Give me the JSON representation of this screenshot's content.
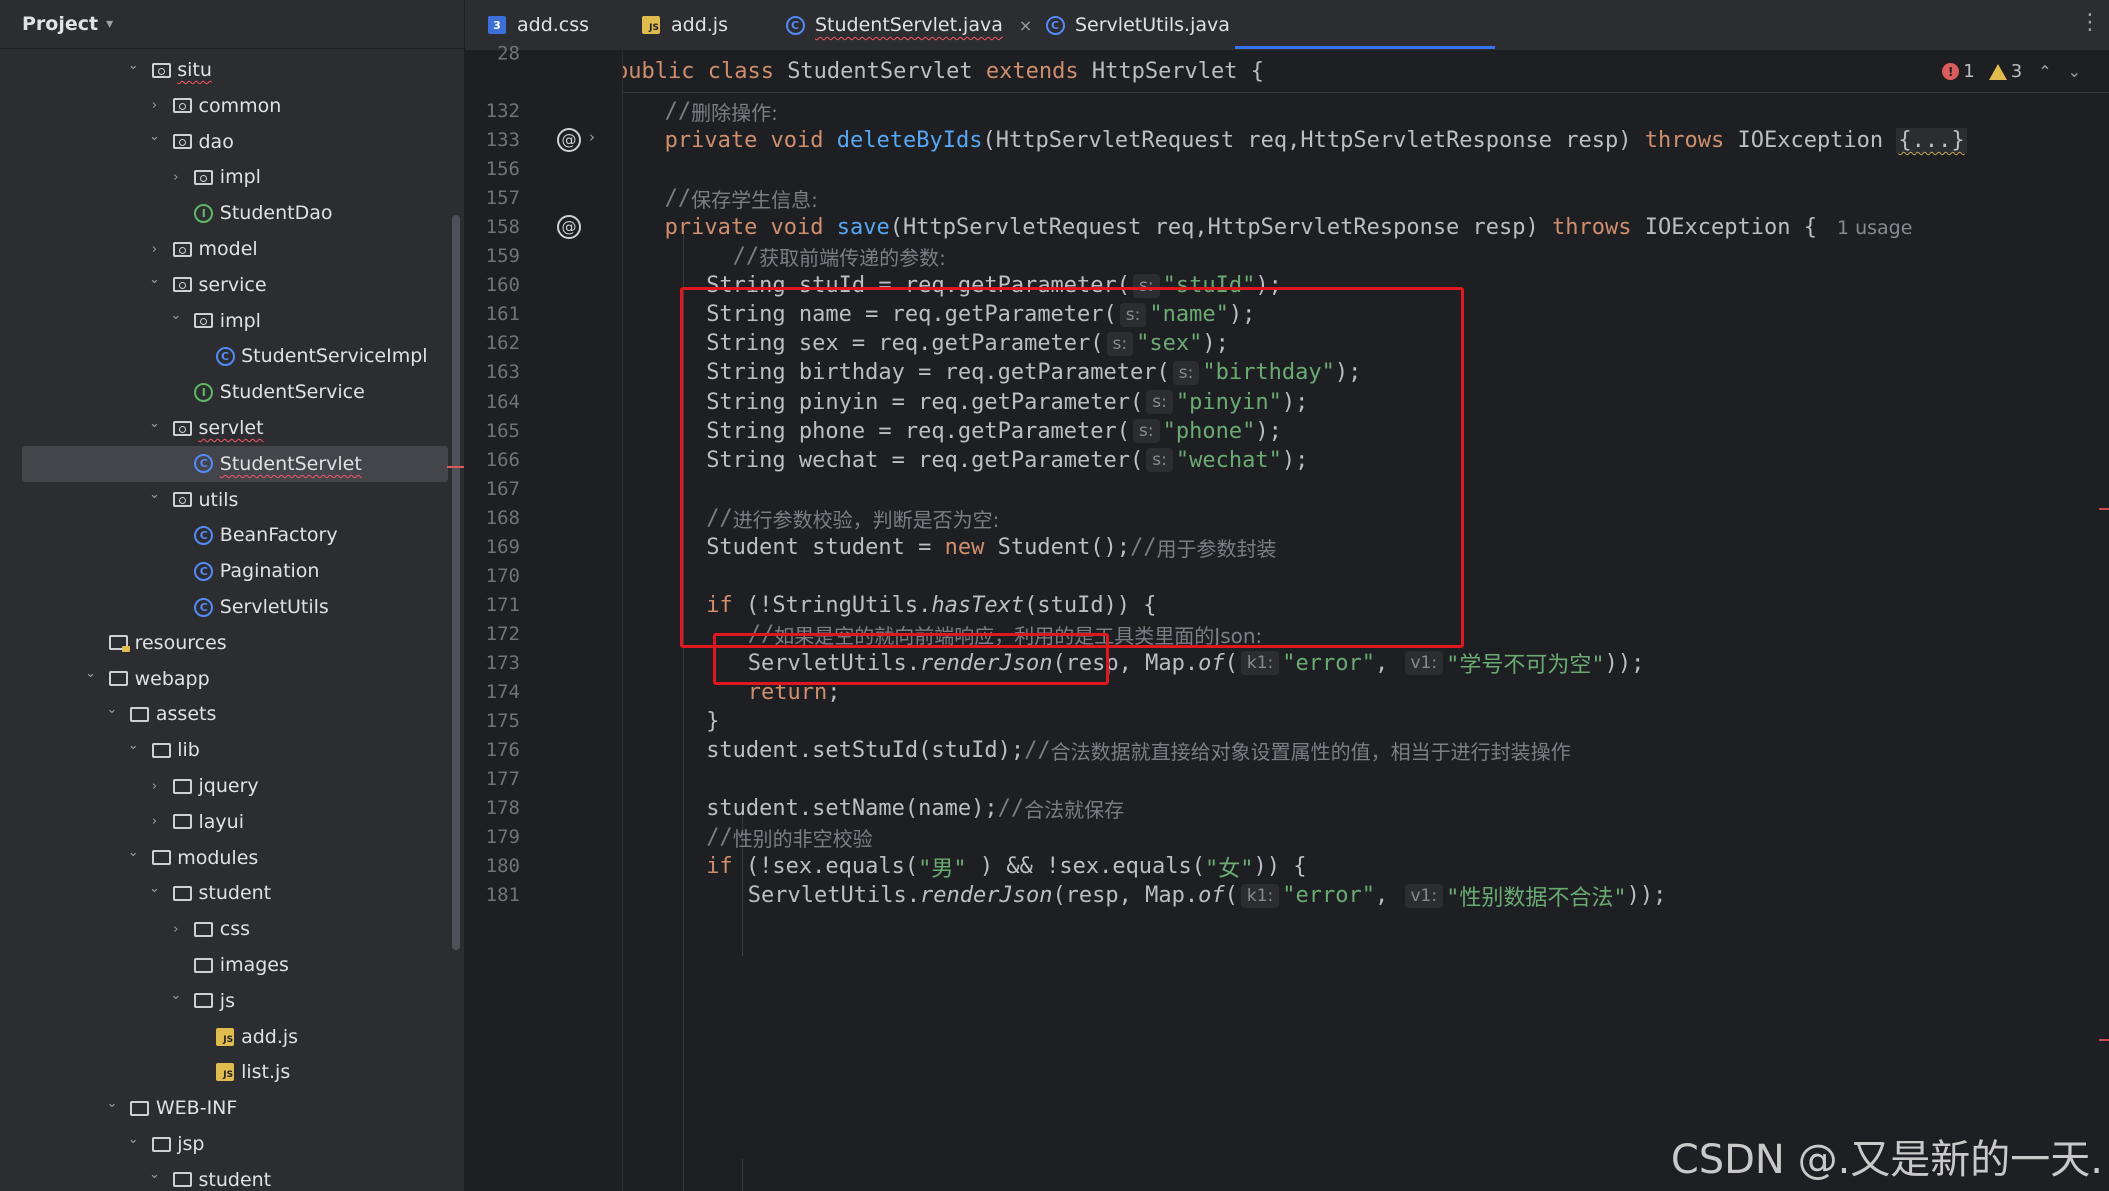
{
  "project": {
    "title": "Project",
    "tree": [
      {
        "label": "situ",
        "type": "package",
        "chev": "v",
        "indent": 4,
        "squig": true
      },
      {
        "label": "common",
        "type": "package",
        "chev": ">",
        "indent": 5
      },
      {
        "label": "dao",
        "type": "package",
        "chev": "v",
        "indent": 5
      },
      {
        "label": "impl",
        "type": "package",
        "chev": ">",
        "indent": 6
      },
      {
        "label": "StudentDao",
        "type": "interface",
        "chev": "",
        "indent": 6
      },
      {
        "label": "model",
        "type": "package",
        "chev": ">",
        "indent": 5
      },
      {
        "label": "service",
        "type": "package",
        "chev": "v",
        "indent": 5
      },
      {
        "label": "impl",
        "type": "package",
        "chev": "v",
        "indent": 6
      },
      {
        "label": "StudentServiceImpl",
        "type": "class",
        "chev": "",
        "indent": 7
      },
      {
        "label": "StudentService",
        "type": "interface",
        "chev": "",
        "indent": 6
      },
      {
        "label": "servlet",
        "type": "package",
        "chev": "v",
        "indent": 5,
        "squig": true
      },
      {
        "label": "StudentServlet",
        "type": "class",
        "chev": "",
        "indent": 6,
        "squig": true,
        "selected": true
      },
      {
        "label": "utils",
        "type": "package",
        "chev": "v",
        "indent": 5
      },
      {
        "label": "BeanFactory",
        "type": "class",
        "chev": "",
        "indent": 6
      },
      {
        "label": "Pagination",
        "type": "class",
        "chev": "",
        "indent": 6
      },
      {
        "label": "ServletUtils",
        "type": "class",
        "chev": "",
        "indent": 6
      },
      {
        "label": "resources",
        "type": "resources",
        "chev": "",
        "indent": 2
      },
      {
        "label": "webapp",
        "type": "folder",
        "chev": "v",
        "indent": 2
      },
      {
        "label": "assets",
        "type": "folder",
        "chev": "v",
        "indent": 3
      },
      {
        "label": "lib",
        "type": "folder",
        "chev": "v",
        "indent": 4
      },
      {
        "label": "jquery",
        "type": "folder",
        "chev": ">",
        "indent": 5
      },
      {
        "label": "layui",
        "type": "folder",
        "chev": ">",
        "indent": 5
      },
      {
        "label": "modules",
        "type": "folder",
        "chev": "v",
        "indent": 4
      },
      {
        "label": "student",
        "type": "folder",
        "chev": "v",
        "indent": 5
      },
      {
        "label": "css",
        "type": "folder",
        "chev": ">",
        "indent": 6
      },
      {
        "label": "images",
        "type": "folder",
        "chev": "",
        "indent": 6
      },
      {
        "label": "js",
        "type": "folder",
        "chev": "v",
        "indent": 6
      },
      {
        "label": "add.js",
        "type": "js",
        "chev": "",
        "indent": 7
      },
      {
        "label": "list.js",
        "type": "js",
        "chev": "",
        "indent": 7
      },
      {
        "label": "WEB-INF",
        "type": "folder",
        "chev": "v",
        "indent": 3
      },
      {
        "label": "jsp",
        "type": "folder",
        "chev": "v",
        "indent": 4
      },
      {
        "label": "student",
        "type": "folder",
        "chev": "v",
        "indent": 5
      }
    ]
  },
  "tabs": [
    {
      "label": "add.css",
      "icon": "css-file-icon",
      "active": false
    },
    {
      "label": "add.js",
      "icon": "js-file-icon",
      "active": false
    },
    {
      "label": "StudentServlet.java",
      "icon": "java-class-icon",
      "active": true,
      "close": "×"
    },
    {
      "label": "ServletUtils.java",
      "icon": "java-class-icon",
      "active": false
    }
  ],
  "tabs_more": "⋮",
  "inspections": {
    "errors": "1",
    "warnings": "3",
    "up": "⌃",
    "down": "⌄"
  },
  "editor": {
    "sticky": {
      "num": "28",
      "segs": [
        [
          "kw",
          "public class "
        ],
        [
          "",
          "StudentServlet "
        ],
        [
          "kw",
          "extends "
        ],
        [
          "",
          "HttpServlet {"
        ]
      ]
    },
    "lines": [
      {
        "num": "132",
        "indent": 1,
        "segs": [
          [
            "cm",
            "//"
          ],
          [
            "cmz",
            "删除操作:"
          ]
        ]
      },
      {
        "num": "133",
        "indent": 1,
        "gutter": "@",
        "fold": true,
        "segs": [
          [
            "kw",
            "private void "
          ],
          [
            "fn",
            "deleteByIds"
          ],
          [
            "",
            "(HttpServletRequest req,HttpServletResponse resp) "
          ],
          [
            "kw",
            "throws "
          ],
          [
            "",
            "IOException "
          ],
          [
            "fold",
            "{...}"
          ]
        ]
      },
      {
        "num": "156",
        "indent": 0,
        "segs": []
      },
      {
        "num": "157",
        "indent": 1,
        "segs": [
          [
            "cm",
            "//"
          ],
          [
            "cmz",
            "保存学生信息:"
          ]
        ]
      },
      {
        "num": "158",
        "indent": 1,
        "gutter": "@",
        "segs": [
          [
            "kw",
            "private void "
          ],
          [
            "fn",
            "save"
          ],
          [
            "",
            "(HttpServletRequest req,HttpServletResponse resp) "
          ],
          [
            "kw",
            "throws "
          ],
          [
            "",
            "IOException {"
          ],
          [
            "usage",
            "1 usage"
          ]
        ]
      },
      {
        "num": "159",
        "indent": 2,
        "segs": [
          [
            "cm",
            "  //"
          ],
          [
            "cmz",
            "获取前端传递的参数:"
          ]
        ]
      },
      {
        "num": "160",
        "indent": 2,
        "segs": [
          [
            "",
            "String stuId = req.getParameter("
          ],
          [
            "hint",
            "s:"
          ],
          [
            "str",
            "\"stuId\""
          ],
          [
            "",
            ");"
          ]
        ]
      },
      {
        "num": "161",
        "indent": 2,
        "segs": [
          [
            "",
            "String name = req.getParameter("
          ],
          [
            "hint",
            "s:"
          ],
          [
            "str",
            "\"name\""
          ],
          [
            "",
            ");"
          ]
        ]
      },
      {
        "num": "162",
        "indent": 2,
        "segs": [
          [
            "",
            "String sex = req.getParameter("
          ],
          [
            "hint",
            "s:"
          ],
          [
            "str",
            "\"sex\""
          ],
          [
            "",
            ");"
          ]
        ]
      },
      {
        "num": "163",
        "indent": 2,
        "segs": [
          [
            "",
            "String birthday = req.getParameter("
          ],
          [
            "hint",
            "s:"
          ],
          [
            "str",
            "\"birthday\""
          ],
          [
            "",
            ");"
          ]
        ]
      },
      {
        "num": "164",
        "indent": 2,
        "segs": [
          [
            "",
            "String pinyin = req.getParameter("
          ],
          [
            "hint",
            "s:"
          ],
          [
            "str",
            "\"pinyin\""
          ],
          [
            "",
            ");"
          ]
        ]
      },
      {
        "num": "165",
        "indent": 2,
        "segs": [
          [
            "",
            "String phone = req.getParameter("
          ],
          [
            "hint",
            "s:"
          ],
          [
            "str",
            "\"phone\""
          ],
          [
            "",
            ");"
          ]
        ]
      },
      {
        "num": "166",
        "indent": 2,
        "segs": [
          [
            "",
            "String wechat = req.getParameter("
          ],
          [
            "hint",
            "s:"
          ],
          [
            "str",
            "\"wechat\""
          ],
          [
            "",
            ");"
          ]
        ]
      },
      {
        "num": "167",
        "indent": 0,
        "segs": []
      },
      {
        "num": "168",
        "indent": 2,
        "segs": [
          [
            "cm",
            "//"
          ],
          [
            "cmz",
            "进行参数校验，判断是否为空:"
          ]
        ]
      },
      {
        "num": "169",
        "indent": 2,
        "segs": [
          [
            "",
            "Student student = "
          ],
          [
            "kw",
            "new "
          ],
          [
            "",
            "Student();"
          ],
          [
            "cm",
            "//"
          ],
          [
            "cmz",
            "用于参数封装"
          ]
        ]
      },
      {
        "num": "170",
        "indent": 0,
        "segs": []
      },
      {
        "num": "171",
        "indent": 2,
        "segs": [
          [
            "kw",
            "if "
          ],
          [
            "",
            "(!StringUtils."
          ],
          [
            "fi",
            "hasText"
          ],
          [
            "",
            "(stuId)) {"
          ]
        ]
      },
      {
        "num": "172",
        "indent": 3,
        "segs": [
          [
            "cm",
            "//"
          ],
          [
            "cmz",
            "如果是空的就向前端响应，利用的是工具类里面的Json:"
          ]
        ]
      },
      {
        "num": "173",
        "indent": 3,
        "segs": [
          [
            "",
            "ServletUtils."
          ],
          [
            "fi",
            "renderJson"
          ],
          [
            "",
            "(resp, Map."
          ],
          [
            "fi",
            "of"
          ],
          [
            "",
            "("
          ],
          [
            "hint",
            "k1:"
          ],
          [
            "str",
            "\"error\""
          ],
          [
            "",
            ", "
          ],
          [
            "hint",
            "v1:"
          ],
          [
            "str",
            "\"学号不可为空\""
          ],
          [
            "",
            "));"
          ]
        ]
      },
      {
        "num": "174",
        "indent": 3,
        "segs": [
          [
            "kw",
            "return"
          ],
          [
            "",
            ";"
          ]
        ]
      },
      {
        "num": "175",
        "indent": 2,
        "segs": [
          [
            "",
            "}"
          ]
        ]
      },
      {
        "num": "176",
        "indent": 2,
        "segs": [
          [
            "",
            "student.setStuId(stuId);"
          ],
          [
            "cm",
            "//"
          ],
          [
            "cmz",
            "合法数据就直接给对象设置属性的值，相当于进行封装操作"
          ]
        ]
      },
      {
        "num": "177",
        "indent": 0,
        "segs": []
      },
      {
        "num": "178",
        "indent": 2,
        "segs": [
          [
            "",
            "student.setName(name);"
          ],
          [
            "cm",
            "//"
          ],
          [
            "cmz",
            "合法就保存"
          ]
        ]
      },
      {
        "num": "179",
        "indent": 2,
        "segs": [
          [
            "cm",
            "//"
          ],
          [
            "cmz",
            "性别的非空校验"
          ]
        ]
      },
      {
        "num": "180",
        "indent": 2,
        "segs": [
          [
            "kw",
            "if "
          ],
          [
            "",
            "(!sex.equals("
          ],
          [
            "str",
            "\"男\""
          ],
          [
            "",
            " ) && !sex.equals("
          ],
          [
            "str",
            "\"女\""
          ],
          [
            "",
            ")) {"
          ]
        ]
      },
      {
        "num": "181",
        "indent": 3,
        "segs": [
          [
            "",
            "ServletUtils."
          ],
          [
            "fi",
            "renderJson"
          ],
          [
            "",
            "(resp, Map."
          ],
          [
            "fi",
            "of"
          ],
          [
            "",
            "("
          ],
          [
            "hint",
            "k1:"
          ],
          [
            "str",
            "\"error\""
          ],
          [
            "",
            ", "
          ],
          [
            "hint",
            "v1:"
          ],
          [
            "str",
            "\"性别数据不合法\""
          ],
          [
            "",
            "));"
          ]
        ]
      }
    ]
  },
  "watermark": "CSDN @.又是新的一天.",
  "colors": {
    "keyword": "#cf8e6d",
    "function": "#56a8f5",
    "string": "#6aab73",
    "comment": "#7a7e85",
    "highlight_box": "#e0171f",
    "accent": "#3574f0"
  }
}
